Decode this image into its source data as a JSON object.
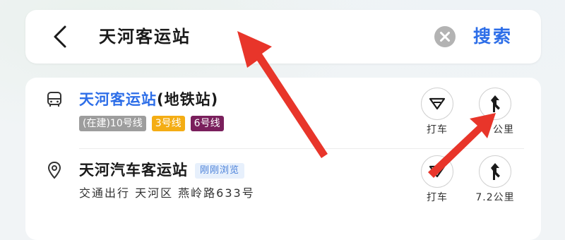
{
  "search": {
    "query": "天河客运站",
    "search_label": "搜索"
  },
  "results": [
    {
      "title_highlight": "天河客运站",
      "title_suffix": "(地铁站)",
      "type_icon": "bus-icon",
      "tags": [
        {
          "label": "(在建)10号线",
          "color": "#9d9d9d"
        },
        {
          "label": "3号线",
          "color": "#f4ad14"
        },
        {
          "label": "6号线",
          "color": "#7a1f5c"
        }
      ],
      "taxi_label": "打车",
      "route_label": "公里"
    },
    {
      "title": "天河汽车客运站",
      "type_icon": "location-pin-icon",
      "badge": "刚刚浏览",
      "address": "交通出行 天河区 燕岭路633号",
      "taxi_label": "打车",
      "route_label": "7.2公里"
    }
  ],
  "colors": {
    "accent": "#2d6ee8",
    "annotation_arrow": "#e8352a"
  }
}
